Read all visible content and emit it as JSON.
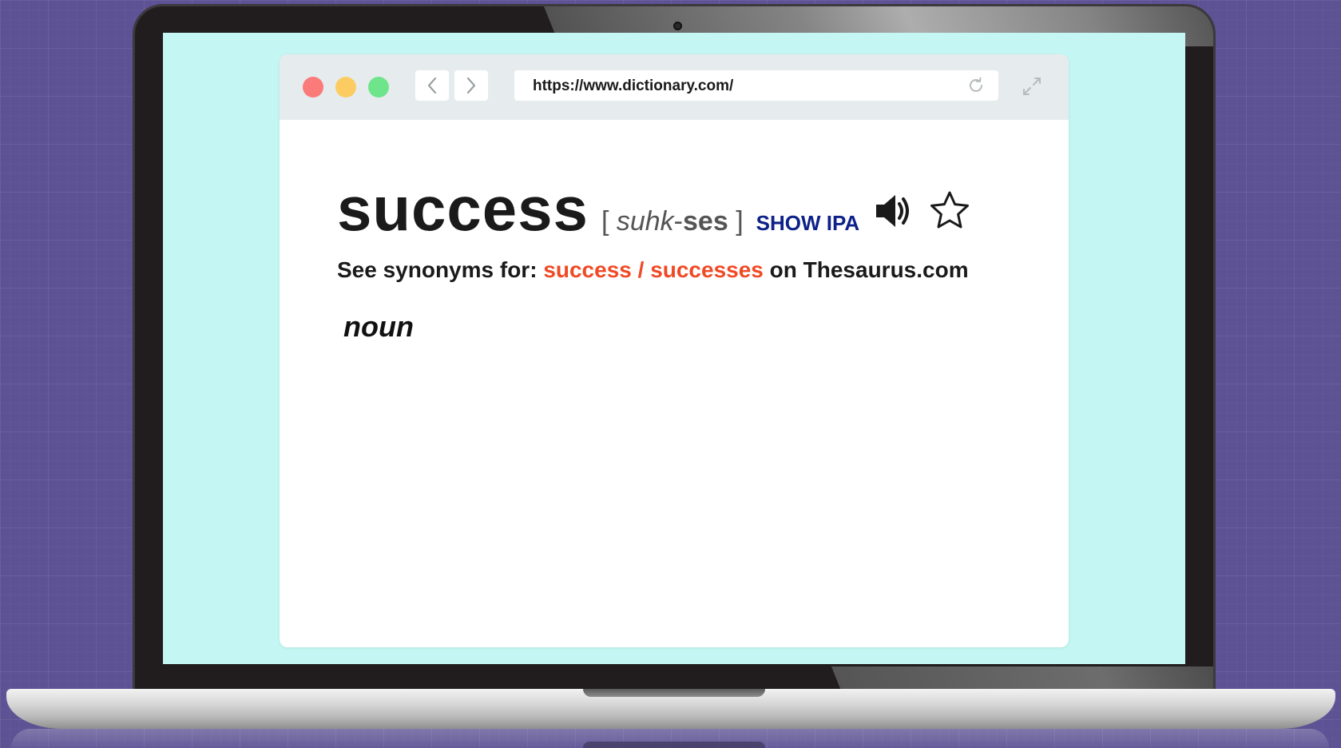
{
  "browser": {
    "url": "https://www.dictionary.com/",
    "traffic_lights": {
      "close_color": "#fb7a7a",
      "minimize_color": "#fccc63",
      "zoom_color": "#6ee48b"
    }
  },
  "entry": {
    "headword": "success",
    "pron_open": "[",
    "pron_syl1": "suhk",
    "pron_hyphen": "-",
    "pron_syl2": "ses",
    "pron_close": "]",
    "show_ipa": "SHOW IPA",
    "synonyms_prefix": "See synonyms for: ",
    "synonyms_link": "success / successes",
    "synonyms_suffix": " on Thesaurus.com",
    "part_of_speech": "noun"
  },
  "colors": {
    "background": "#5d5294",
    "screen": "#c4f7f3",
    "link": "#f04a25",
    "show_ipa": "#0d2189"
  }
}
